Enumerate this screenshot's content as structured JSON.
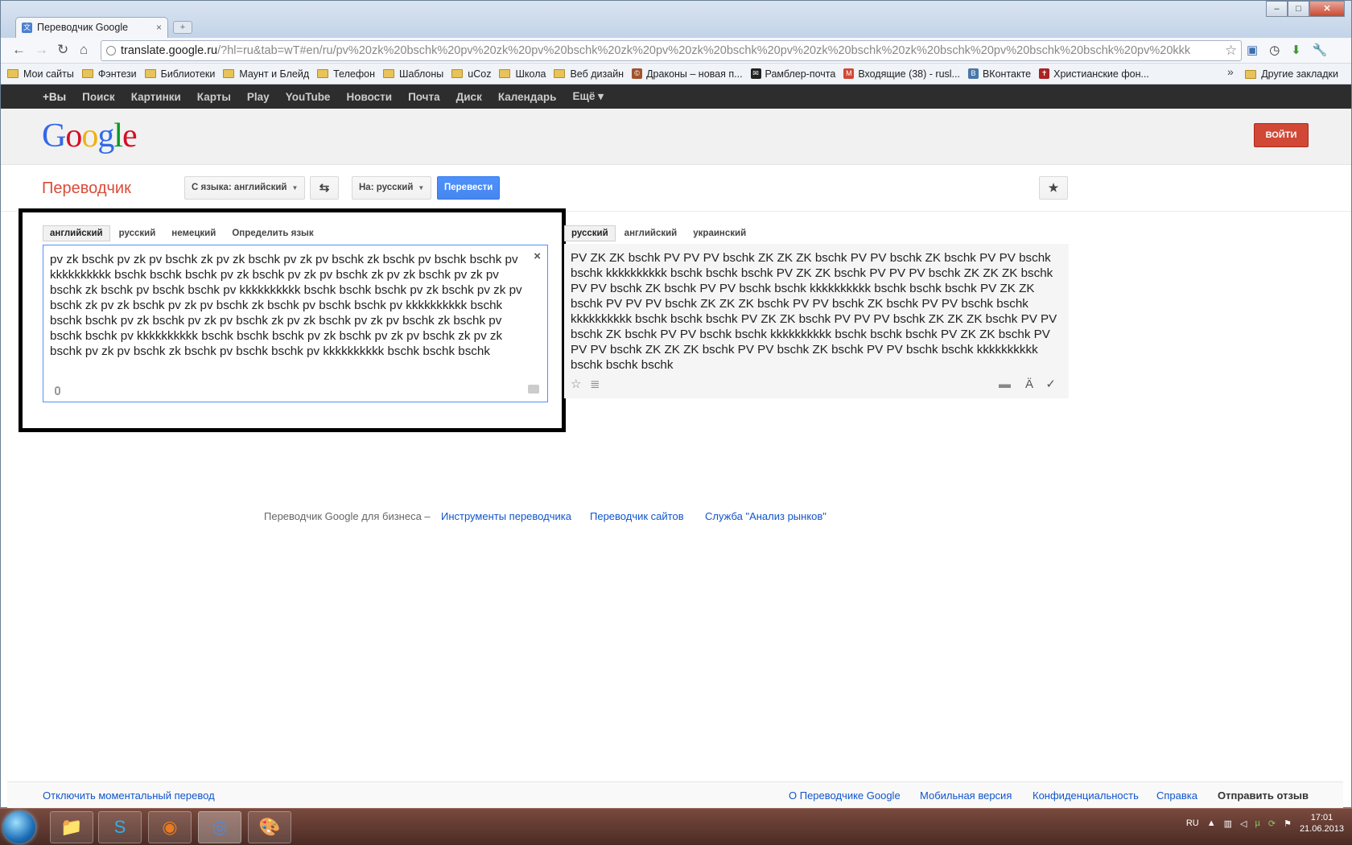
{
  "browser": {
    "tab_title": "Переводчик Google",
    "tab_close": "×",
    "new_tab": "+",
    "url_host": "translate.google.ru",
    "url_rest": "/?hl=ru&tab=wT#en/ru/pv%20zk%20bschk%20pv%20zk%20pv%20bschk%20zk%20pv%20zk%20bschk%20pv%20zk%20bschk%20zk%20bschk%20pv%20bschk%20bschk%20pv%20kkk",
    "bookmarks": [
      "Мои сайты",
      "Фэнтези",
      "Библиотеки",
      "Маунт и Блейд",
      "Телефон",
      "Шаблоны",
      "uCoz",
      "Школа",
      "Веб дизайн"
    ],
    "bookmarks_sites": [
      {
        "label": "Драконы – новая п...",
        "color": "#a0522d",
        "glyph": "©"
      },
      {
        "label": "Рамблер-почта",
        "color": "#222",
        "glyph": "✉"
      },
      {
        "label": "Входящие (38) - rusl...",
        "color": "#d14836",
        "glyph": "M"
      },
      {
        "label": "ВКонтакте",
        "color": "#4a76a8",
        "glyph": "B"
      },
      {
        "label": "Христианские фон...",
        "color": "#a22",
        "glyph": "✝"
      }
    ],
    "bookmarks_more": "»",
    "other_bookmarks": "Другие закладки"
  },
  "gbar": {
    "items": [
      "+Вы",
      "Поиск",
      "Картинки",
      "Карты",
      "Play",
      "YouTube",
      "Новости",
      "Почта",
      "Диск",
      "Календарь",
      "Ещё ▾"
    ]
  },
  "header": {
    "logo": "Google",
    "login": "ВОЙТИ"
  },
  "translator": {
    "title": "Переводчик",
    "from_lang": "С языка: английский",
    "to_lang": "На: русский",
    "translate": "Перевести",
    "swap": "⇆"
  },
  "source": {
    "tabs": [
      "английский",
      "русский",
      "немецкий",
      "Определить язык"
    ],
    "text": "pv zk bschk pv zk pv bschk zk pv zk bschk pv zk pv bschk zk bschk pv bschk bschk pv kkkkkkkkkk bschk bschk bschk pv zk bschk pv zk pv bschk zk pv zk bschk pv zk pv bschk zk bschk pv bschk bschk pv kkkkkkkkkk bschk bschk bschk pv zk bschk pv zk pv bschk zk pv zk bschk pv zk pv bschk zk bschk pv bschk bschk pv kkkkkkkkkk bschk bschk bschk pv zk bschk pv zk pv bschk zk pv zk bschk pv zk pv bschk zk bschk pv bschk bschk pv kkkkkkkkkk bschk bschk bschk pv zk bschk pv zk pv bschk zk pv zk bschk pv zk pv bschk zk bschk pv bschk bschk pv kkkkkkkkkk bschk bschk bschk",
    "clear": "×"
  },
  "result": {
    "tabs": [
      "русский",
      "английский",
      "украинский"
    ],
    "text": "PV ZK ZK bschk PV PV PV bschk ZK ZK ZK bschk PV PV bschk ZK bschk PV PV bschk bschk kkkkkkkkkk bschk bschk bschk PV ZK ZK bschk PV PV PV bschk ZK ZK ZK bschk PV PV bschk ZK bschk PV PV bschk bschk kkkkkkkkkk bschk bschk bschk PV ZK ZK bschk PV PV PV bschk ZK ZK ZK bschk PV PV bschk ZK bschk PV PV bschk bschk kkkkkkkkkk bschk bschk bschk PV ZK ZK bschk PV PV PV bschk ZK ZK ZK bschk PV PV bschk ZK bschk PV PV bschk bschk kkkkkkkkkk bschk bschk bschk PV ZK ZK bschk PV PV PV bschk ZK ZK ZK bschk PV PV bschk ZK bschk PV PV bschk bschk kkkkkkkkkk bschk bschk bschk"
  },
  "business": {
    "lead": "Переводчик Google для бизнеса –",
    "links": [
      "Инструменты переводчика",
      "Переводчик сайтов",
      "Служба \"Анализ рынков\""
    ]
  },
  "footer": {
    "left": "Отключить моментальный перевод",
    "links": [
      "О Переводчике Google",
      "Мобильная версия",
      "Конфиденциальность",
      "Справка"
    ],
    "feedback": "Отправить отзыв"
  },
  "taskbar": {
    "lang": "RU",
    "time": "17:01",
    "date": "21.06.2013"
  }
}
